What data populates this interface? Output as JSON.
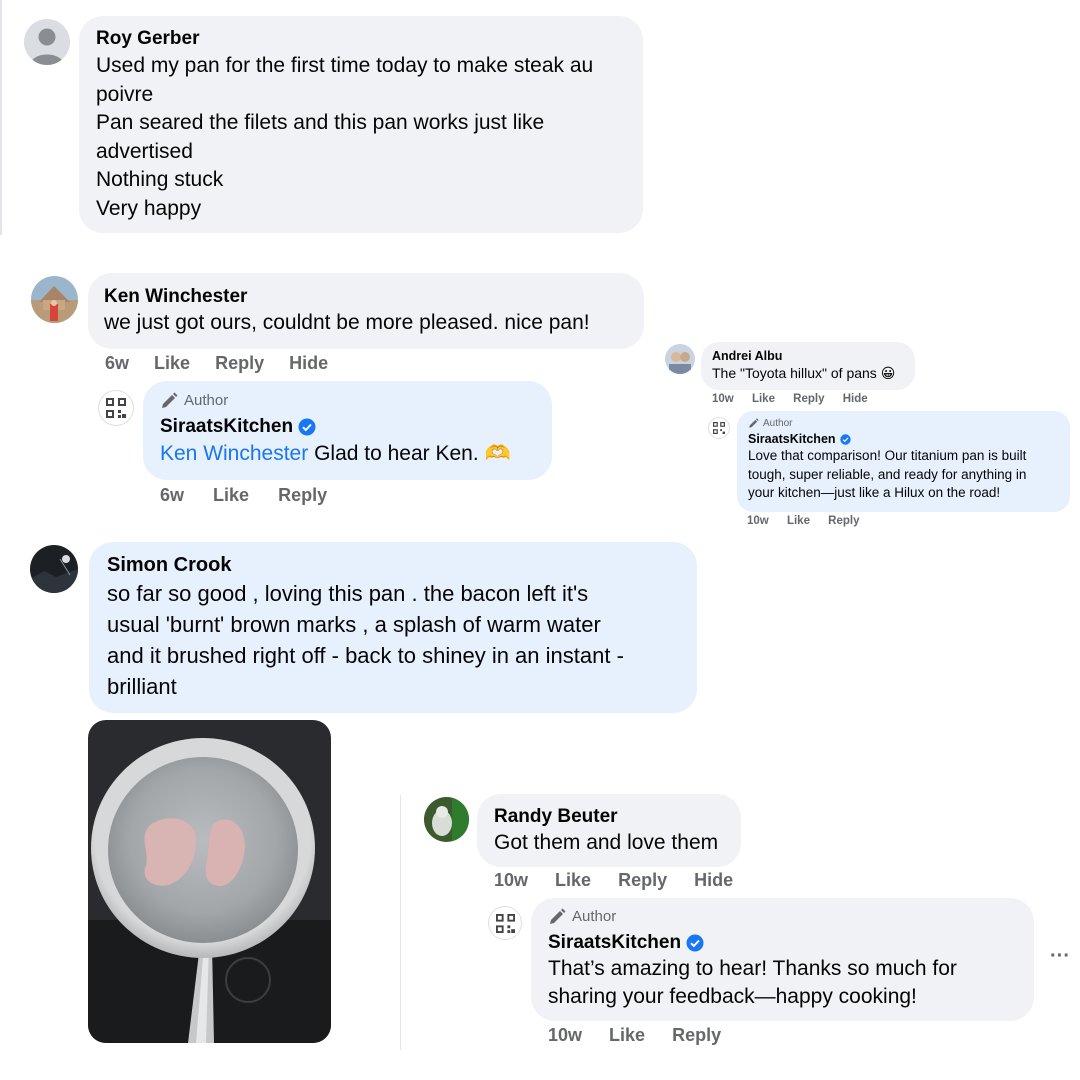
{
  "comments": {
    "roy": {
      "name": "Roy Gerber",
      "text": "Used my pan for the first time today to make steak au\npoivre\nPan seared the filets and this pan works just like\nadvertised\nNothing stuck\nVery happy"
    },
    "ken": {
      "name": "Ken Winchester",
      "text": "we just got ours, couldnt be more pleased. nice pan!",
      "time": "6w",
      "like": "Like",
      "reply": "Reply",
      "hide": "Hide",
      "reply_comment": {
        "author_badge": "Author",
        "name": "SiraatsKitchen",
        "mention": "Ken Winchester",
        "text": " Glad to hear Ken. 🫶",
        "time": "6w",
        "like": "Like",
        "reply": "Reply"
      }
    },
    "andrei": {
      "name": "Andrei Albu",
      "text": "The \"Toyota hillux\" of pans 😀",
      "time": "10w",
      "like": "Like",
      "reply": "Reply",
      "hide": "Hide",
      "reply_comment": {
        "author_badge": "Author",
        "name": "SiraatsKitchen",
        "text": "Love that comparison! Our titanium pan is built\ntough, super reliable, and ready for anything in\nyour kitchen—just like a Hilux on the road!",
        "time": "10w",
        "like": "Like",
        "reply": "Reply"
      }
    },
    "simon": {
      "name": "Simon Crook",
      "text": "so far so good , loving this pan . the bacon left it's\nusual 'burnt' brown marks , a splash of warm water\nand it brushed right off - back to shiney in an instant -\nbrilliant"
    },
    "randy": {
      "name": "Randy Beuter",
      "text": "Got them and love them",
      "time": "10w",
      "like": "Like",
      "reply": "Reply",
      "hide": "Hide",
      "reply_comment": {
        "author_badge": "Author",
        "name": "SiraatsKitchen",
        "text": "That’s amazing to hear! Thanks so much for\nsharing your feedback—happy cooking!",
        "time": "10w",
        "like": "Like",
        "reply": "Reply",
        "more": "···"
      }
    }
  },
  "colors": {
    "bubble_gray": "#f0f2f5",
    "bubble_blue": "#e7f0fd",
    "mention_blue": "#1877f2",
    "meta_gray": "#65676b"
  },
  "icons": [
    "default-avatar-icon",
    "pencil-icon",
    "verified-badge-icon",
    "qr-logo-icon",
    "more-options-icon"
  ]
}
